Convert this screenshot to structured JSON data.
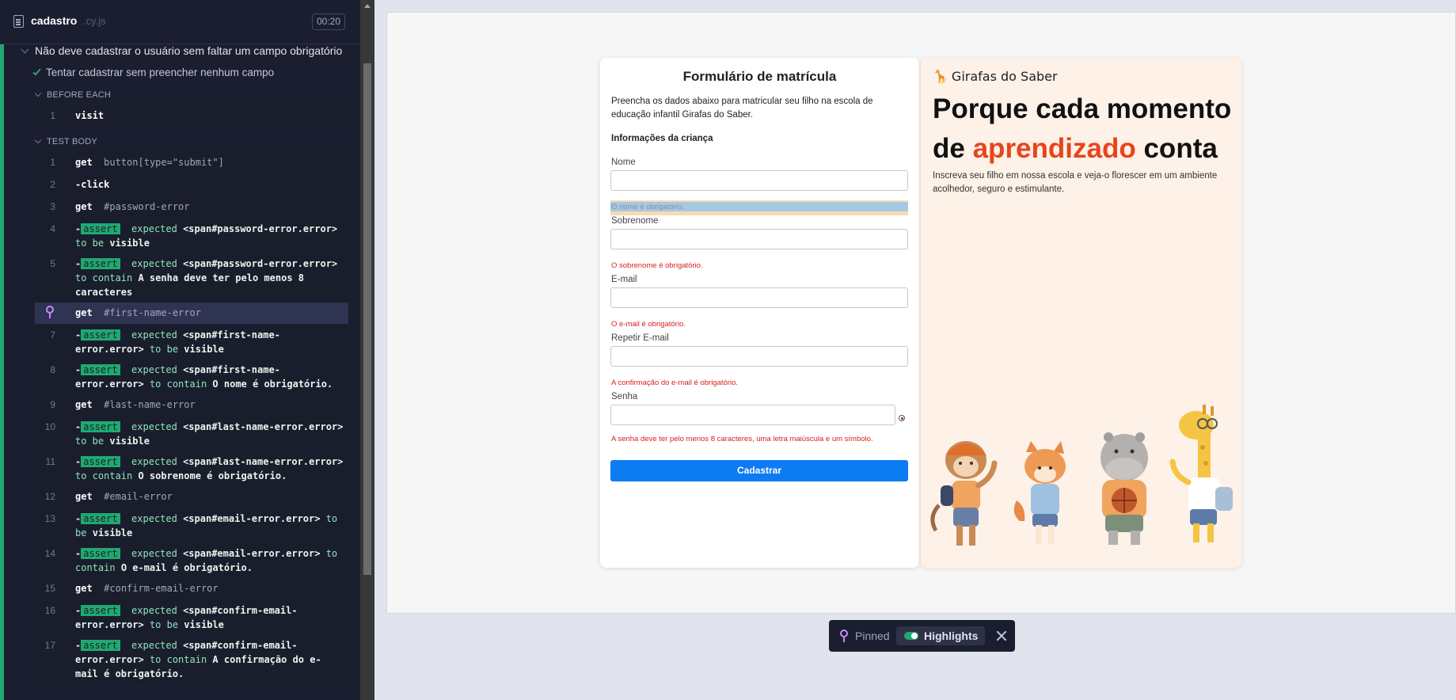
{
  "reporter": {
    "spec_name": "cadastro",
    "spec_ext": ".cy.js",
    "duration": "00:20",
    "suite_title": "Não deve cadastrar o usuário sem faltar um campo obrigatório",
    "test_title": "Tentar cadastrar sem preencher nenhum campo",
    "before_each_label": "BEFORE EACH",
    "test_body_label": "TEST BODY",
    "before_each": [
      {
        "num": "1",
        "name": "visit"
      }
    ],
    "commands": [
      {
        "num": "1",
        "name": "get",
        "arg": "button[type=\"submit\"]"
      },
      {
        "num": "2",
        "name": "-click"
      },
      {
        "num": "3",
        "name": "get",
        "arg": "#password-error"
      },
      {
        "num": "4",
        "badge": "assert",
        "l1": "expected",
        "l2": "<span#password-error.error>",
        "l3": "to be",
        "l4": "visible"
      },
      {
        "num": "5",
        "badge": "assert",
        "l1": "expected",
        "l2": "<span#password-error.error>",
        "l3": "to contain",
        "l4": "A senha deve ter pelo menos 8 caracteres"
      },
      {
        "num": "",
        "name": "get",
        "arg": "#first-name-error"
      },
      {
        "num": "7",
        "badge": "assert",
        "l1": "expected",
        "l2": "<span#first-name-error.error>",
        "l3": "to be",
        "l4": "visible"
      },
      {
        "num": "8",
        "badge": "assert",
        "l1": "expected",
        "l2": "<span#first-name-error.error>",
        "l3": "to contain",
        "l4": "O nome é obrigatório."
      },
      {
        "num": "9",
        "name": "get",
        "arg": "#last-name-error"
      },
      {
        "num": "10",
        "badge": "assert",
        "l1": "expected",
        "l2": "<span#last-name-error.error>",
        "l3": "to be",
        "l4": "visible"
      },
      {
        "num": "11",
        "badge": "assert",
        "l1": "expected",
        "l2": "<span#last-name-error.error>",
        "l3": "to contain",
        "l4": "O sobrenome é obrigatório."
      },
      {
        "num": "12",
        "name": "get",
        "arg": "#email-error"
      },
      {
        "num": "13",
        "badge": "assert",
        "l1": "expected",
        "l2": "<span#email-error.error>",
        "l3": "to be",
        "l4": "visible"
      },
      {
        "num": "14",
        "badge": "assert",
        "l1": "expected",
        "l2": "<span#email-error.error>",
        "l3": "to contain",
        "l4": "O e-mail é obrigatório."
      },
      {
        "num": "15",
        "name": "get",
        "arg": "#confirm-email-error"
      },
      {
        "num": "16",
        "badge": "assert",
        "l1": "expected",
        "l2": "<span#confirm-email-error.error>",
        "l3": "to be",
        "l4": "visible"
      },
      {
        "num": "17",
        "badge": "assert",
        "l1": "expected",
        "l2": "<span#confirm-email-error.error>",
        "l3": "to contain",
        "l4": "A confirmação do e-mail é obrigatório."
      }
    ]
  },
  "form": {
    "title": "Formulário de matrícula",
    "intro": "Preencha os dados abaixo para matricular seu filho na escola de educação infantil Girafas do Saber.",
    "section": "Informações da criança",
    "first_name_label": "Nome",
    "first_name_error": "O nome é obrigatório.",
    "last_name_label": "Sobrenome",
    "last_name_error": "O sobrenome é obrigatório.",
    "email_label": "E-mail",
    "email_error": "O e-mail é obrigatório.",
    "confirm_email_label": "Repetir E-mail",
    "confirm_email_error": "A confirmação do e-mail é obrigatório.",
    "password_label": "Senha",
    "password_error": "A senha deve ter pelo menos 8 caracteres, uma letra maiúscula e um símbolo.",
    "submit_label": "Cadastrar"
  },
  "hero": {
    "brand": "Girafas do Saber",
    "title_line1": "Porque cada momento",
    "title_de": "de",
    "title_accent": "aprendizado",
    "title_end": "conta",
    "subtitle": "Inscreva seu filho em nossa escola e veja-o florescer em um ambiente acolhedor, seguro e estimulante."
  },
  "pinned_bar": {
    "pinned_label": "Pinned",
    "highlights_label": "Highlights",
    "highlights_on": true
  },
  "colors": {
    "reporter_bg": "#1b1e2e",
    "pass_green": "#1fa971",
    "pin_purple": "#c88bff",
    "error_red": "#d81e1e",
    "submit_blue": "#0d7bf2",
    "hero_accent": "#e8441c"
  }
}
